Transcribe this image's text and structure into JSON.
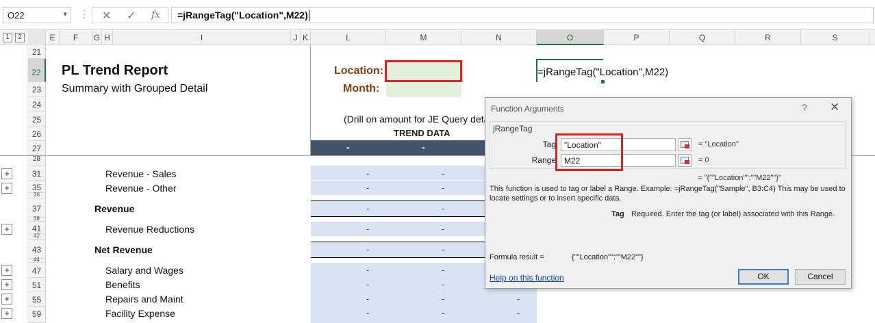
{
  "formula_bar": {
    "name_box": "O22",
    "formula": "=jRangeTag(\"Location\",M22)",
    "cancel_glyph": "✕",
    "enter_glyph": "✓",
    "fx_glyph": "fx"
  },
  "outline_levels": [
    "1",
    "2"
  ],
  "columns": [
    "E",
    "F",
    "G",
    "H",
    "I",
    "J",
    "K",
    "L",
    "M",
    "N",
    "O",
    "P",
    "Q",
    "R",
    "S"
  ],
  "rows": [
    "21",
    "22",
    "23",
    "24",
    "25",
    "26",
    "27",
    "28",
    "31",
    "35",
    "36",
    "37",
    "38",
    "41",
    "42",
    "43",
    "44",
    "47",
    "51",
    "55",
    "59"
  ],
  "sheet": {
    "title": "PL Trend Report",
    "subtitle": "Summary with Grouped Detail",
    "location_label": "Location:",
    "month_label": "Month:",
    "drill_note": "(Drill on amount for JE Query detail)",
    "trend_header": "TREND DATA",
    "dash": "-",
    "o22_text": "=jRangeTag(\"Location\",M22)",
    "line_items": [
      {
        "label": "Revenue - Sales",
        "bold": false
      },
      {
        "label": "Revenue - Other",
        "bold": false
      },
      {
        "label": "Revenue",
        "bold": true
      },
      {
        "label": "Revenue Reductions",
        "bold": false
      },
      {
        "label": "Net Revenue",
        "bold": true
      },
      {
        "label": "Salary and Wages",
        "bold": false
      },
      {
        "label": "Benefits",
        "bold": false
      },
      {
        "label": "Repairs and Maint",
        "bold": false
      },
      {
        "label": "Facility Expense",
        "bold": false
      }
    ]
  },
  "dialog": {
    "title": "Function Arguments",
    "help_glyph": "?",
    "close_glyph": "✕",
    "function_name": "jRangeTag",
    "tag_label": "Tag",
    "tag_value": "\"Location\"",
    "tag_result": "=   \"Location\"",
    "range_label": "Range",
    "range_value": "M22",
    "range_result": "=   0",
    "overall_result": "=   \"{\"\"Location\"\":\"\"M22\"\"}\"",
    "description": "This function is used to tag or label a Range. Example: =jRangeTag(\"Sample\", B3:C4) This may be used to locate settings or to insert specific data.",
    "arg_help_name": "Tag",
    "arg_help_text": "Required. Enter the tag (or label) associated with this Range.",
    "formula_result_label": "Formula result =",
    "formula_result_value": "{\"\"Location\"\":\"\"M22\"\"}",
    "help_link": "Help on this function",
    "ok_label": "OK",
    "cancel_label": "Cancel"
  },
  "colors": {
    "accent_green": "#217346",
    "highlight_red": "#e02020",
    "label_brown": "#843c0c",
    "header_navy": "#44546a",
    "data_blue": "#dae3f3",
    "input_green": "#e2efda"
  }
}
